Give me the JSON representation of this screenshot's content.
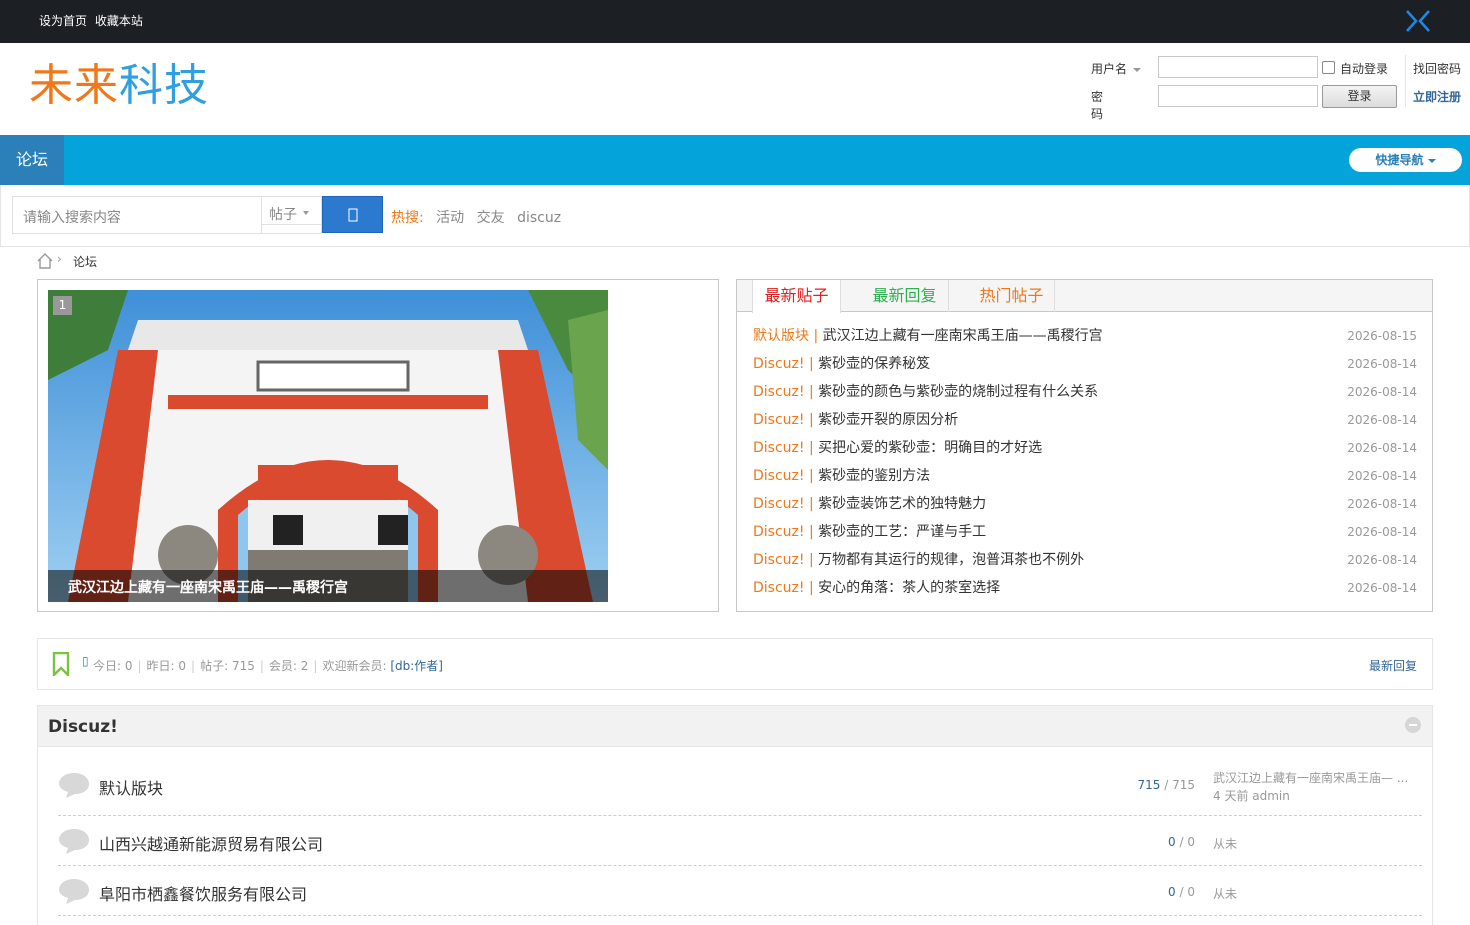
{
  "topbar": {
    "set_home": "设为首页",
    "bookmark": "收藏本站"
  },
  "header": {
    "logo_part1": "未来",
    "logo_part2": "科技",
    "username_label": "用户名",
    "password_label": "密码",
    "auto_login": "自动登录",
    "login_button": "登录",
    "forgot_password": "找回密码",
    "register": "立即注册"
  },
  "nav": {
    "active_tab": "论坛",
    "quick_nav": "快捷导航"
  },
  "search": {
    "placeholder": "请输入搜索内容",
    "type": "帖子",
    "hot_label": "热搜:",
    "hot_terms": [
      "活动",
      "交友",
      "discuz"
    ]
  },
  "breadcrumb": {
    "current": "论坛"
  },
  "slideshow": {
    "index": "1",
    "caption": "武汉江边上藏有一座南宋禹王庙——禹稷行宫"
  },
  "news": {
    "tabs": [
      "最新贴子",
      "最新回复",
      "热门帖子"
    ],
    "items": [
      {
        "forum": "默认版块 |",
        "title": "武汉江边上藏有一座南宋禹王庙——禹稷行宫",
        "date": "2026-08-15"
      },
      {
        "forum": "Discuz! |",
        "title": "紫砂壶的保养秘笈",
        "date": "2026-08-14"
      },
      {
        "forum": "Discuz! |",
        "title": "紫砂壶的颜色与紫砂壶的烧制过程有什么关系",
        "date": "2026-08-14"
      },
      {
        "forum": "Discuz! |",
        "title": "紫砂壶开裂的原因分析",
        "date": "2026-08-14"
      },
      {
        "forum": "Discuz! |",
        "title": "买把心爱的紫砂壶：明确目的才好选",
        "date": "2026-08-14"
      },
      {
        "forum": "Discuz! |",
        "title": "紫砂壶的鉴别方法",
        "date": "2026-08-14"
      },
      {
        "forum": "Discuz! |",
        "title": "紫砂壶装饰艺术的独特魅力",
        "date": "2026-08-14"
      },
      {
        "forum": "Discuz! |",
        "title": "紫砂壶的工艺：严谨与手工",
        "date": "2026-08-14"
      },
      {
        "forum": "Discuz! |",
        "title": "万物都有其运行的规律，泡普洱茶也不例外",
        "date": "2026-08-14"
      },
      {
        "forum": "Discuz! |",
        "title": "安心的角落：茶人的茶室选择",
        "date": "2026-08-14"
      }
    ]
  },
  "stats": {
    "today": "今日: 0",
    "yesterday": "昨日: 0",
    "posts": "帖子: 715",
    "members": "会员: 2",
    "welcome": "欢迎新会员:",
    "new_member": "[db:作者]",
    "latest_replies": "最新回复",
    "separator": "|"
  },
  "forum_group": {
    "title": "Discuz!",
    "forums": [
      {
        "name": "默认版块",
        "threads": "715",
        "posts": "/ 715",
        "last_title": "武汉江边上藏有一座南宋禹王庙— ...",
        "last_meta": "4 天前 admin"
      },
      {
        "name": "山西兴越通新能源贸易有限公司",
        "threads": "0",
        "posts": "/ 0",
        "last_title": "从未",
        "last_meta": ""
      },
      {
        "name": "阜阳市栖鑫餐饮服务有限公司",
        "threads": "0",
        "posts": "/ 0",
        "last_title": "从未",
        "last_meta": ""
      }
    ]
  },
  "colors": {
    "topbar": "#1c1f24",
    "nav": "#04a3d9",
    "nav_active": "#2b80b9",
    "accent_orange": "#f0781a",
    "link_blue": "#336699"
  }
}
